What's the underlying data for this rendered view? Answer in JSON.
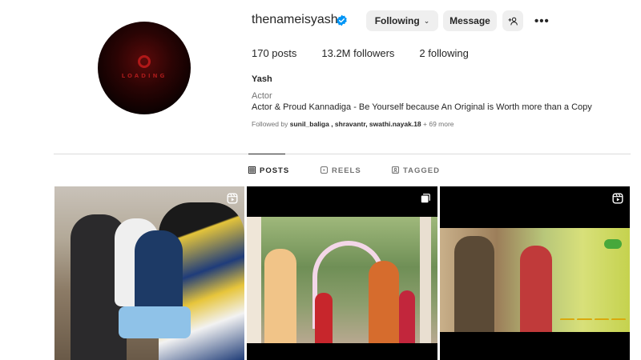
{
  "profile": {
    "username": "thenameisyash",
    "avatar_text": "LOADING",
    "verified": true,
    "verified_color": "#0095f6"
  },
  "actions": {
    "following_label": "Following",
    "message_label": "Message",
    "add_user_icon": "add-user-icon",
    "more_icon": "more-options-icon"
  },
  "stats": {
    "posts": "170 posts",
    "followers": "13.2M followers",
    "following": "2 following"
  },
  "bio": {
    "name": "Yash",
    "category": "Actor",
    "text": "Actor & Proud Kannadiga - Be Yourself because An Original is Worth more than a Copy",
    "followed_prefix": "Followed by ",
    "followed_names": "sunil_baliga , shravantr, swathi.nayak.18",
    "followed_suffix": " + 69 more"
  },
  "tabs": [
    {
      "label": "POSTS",
      "icon": "grid-icon",
      "active": true
    },
    {
      "label": "REELS",
      "icon": "reels-icon",
      "active": false
    },
    {
      "label": "TAGGED",
      "icon": "tagged-icon",
      "active": false
    }
  ],
  "posts": [
    {
      "type": "reel",
      "icon": "reel-icon"
    },
    {
      "type": "carousel",
      "icon": "carousel-icon"
    },
    {
      "type": "reel",
      "icon": "reel-icon"
    }
  ]
}
